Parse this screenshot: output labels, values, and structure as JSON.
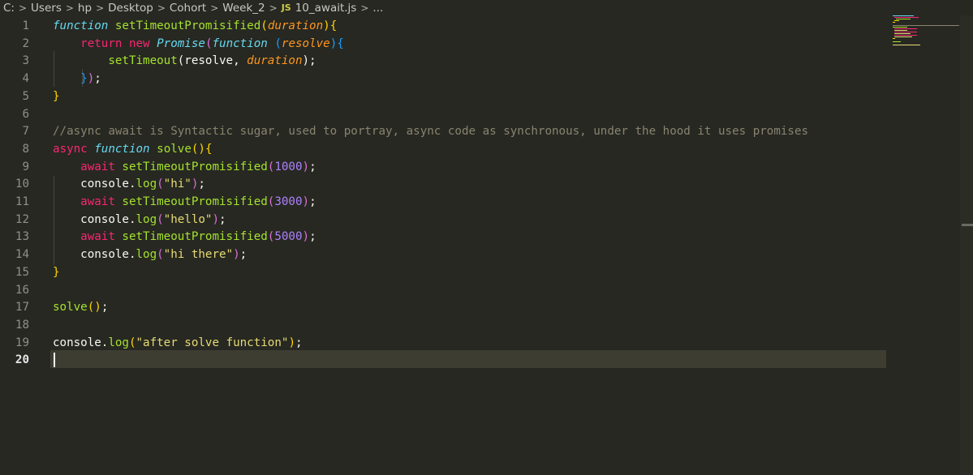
{
  "breadcrumb": {
    "items": [
      "C:",
      "Users",
      "hp",
      "Desktop",
      "Cohort",
      "Week_2"
    ],
    "file_badge": "JS",
    "file_name": "10_await.js",
    "trailing": "..."
  },
  "editor": {
    "current_line": 20,
    "lines": [
      {
        "n": "1",
        "tokens": [
          {
            "t": "function",
            "c": "fnkw"
          },
          {
            "t": " ",
            "c": "plain"
          },
          {
            "t": "setTimeoutPromisified",
            "c": "fn"
          },
          {
            "t": "(",
            "c": "b1"
          },
          {
            "t": "duration",
            "c": "param"
          },
          {
            "t": "){",
            "c": "b1"
          }
        ]
      },
      {
        "n": "2",
        "tokens": [
          {
            "t": "    return",
            "c": "kw"
          },
          {
            "t": " ",
            "c": "plain"
          },
          {
            "t": "new",
            "c": "kw"
          },
          {
            "t": " ",
            "c": "plain"
          },
          {
            "t": "Promise",
            "c": "type"
          },
          {
            "t": "(",
            "c": "b2"
          },
          {
            "t": "function",
            "c": "fnkw"
          },
          {
            "t": " (",
            "c": "b3"
          },
          {
            "t": "resolve",
            "c": "param"
          },
          {
            "t": "){",
            "c": "b3"
          }
        ]
      },
      {
        "n": "3",
        "tokens": [
          {
            "t": "        setTimeout",
            "c": "fn"
          },
          {
            "t": "(resolve, ",
            "c": "plain"
          },
          {
            "t": "duration",
            "c": "param"
          },
          {
            "t": ");",
            "c": "plain"
          }
        ]
      },
      {
        "n": "4",
        "tokens": [
          {
            "t": "    }",
            "c": "b3"
          },
          {
            "t": ")",
            "c": "b2"
          },
          {
            "t": ";",
            "c": "plain"
          }
        ]
      },
      {
        "n": "5",
        "tokens": [
          {
            "t": "}",
            "c": "b1"
          }
        ]
      },
      {
        "n": "6",
        "tokens": []
      },
      {
        "n": "7",
        "tokens": [
          {
            "t": "//async await is Syntactic sugar, used to portray, async code as synchronous, under the hood it uses promises",
            "c": "cm"
          }
        ]
      },
      {
        "n": "8",
        "tokens": [
          {
            "t": "async",
            "c": "kw"
          },
          {
            "t": " ",
            "c": "plain"
          },
          {
            "t": "function",
            "c": "fnkw"
          },
          {
            "t": " ",
            "c": "plain"
          },
          {
            "t": "solve",
            "c": "fn"
          },
          {
            "t": "(){",
            "c": "b1"
          }
        ]
      },
      {
        "n": "9",
        "tokens": [
          {
            "t": "    await",
            "c": "kw"
          },
          {
            "t": " ",
            "c": "plain"
          },
          {
            "t": "setTimeoutPromisified",
            "c": "fn"
          },
          {
            "t": "(",
            "c": "b2"
          },
          {
            "t": "1000",
            "c": "num"
          },
          {
            "t": ")",
            "c": "b2"
          },
          {
            "t": ";",
            "c": "plain"
          }
        ]
      },
      {
        "n": "10",
        "tokens": [
          {
            "t": "    console.",
            "c": "plain"
          },
          {
            "t": "log",
            "c": "fn"
          },
          {
            "t": "(",
            "c": "b2"
          },
          {
            "t": "\"hi\"",
            "c": "str"
          },
          {
            "t": ")",
            "c": "b2"
          },
          {
            "t": ";",
            "c": "plain"
          }
        ]
      },
      {
        "n": "11",
        "tokens": [
          {
            "t": "    await",
            "c": "kw"
          },
          {
            "t": " ",
            "c": "plain"
          },
          {
            "t": "setTimeoutPromisified",
            "c": "fn"
          },
          {
            "t": "(",
            "c": "b2"
          },
          {
            "t": "3000",
            "c": "num"
          },
          {
            "t": ")",
            "c": "b2"
          },
          {
            "t": ";",
            "c": "plain"
          }
        ]
      },
      {
        "n": "12",
        "tokens": [
          {
            "t": "    console.",
            "c": "plain"
          },
          {
            "t": "log",
            "c": "fn"
          },
          {
            "t": "(",
            "c": "b2"
          },
          {
            "t": "\"hello\"",
            "c": "str"
          },
          {
            "t": ")",
            "c": "b2"
          },
          {
            "t": ";",
            "c": "plain"
          }
        ]
      },
      {
        "n": "13",
        "tokens": [
          {
            "t": "    await",
            "c": "kw"
          },
          {
            "t": " ",
            "c": "plain"
          },
          {
            "t": "setTimeoutPromisified",
            "c": "fn"
          },
          {
            "t": "(",
            "c": "b2"
          },
          {
            "t": "5000",
            "c": "num"
          },
          {
            "t": ")",
            "c": "b2"
          },
          {
            "t": ";",
            "c": "plain"
          }
        ]
      },
      {
        "n": "14",
        "tokens": [
          {
            "t": "    console.",
            "c": "plain"
          },
          {
            "t": "log",
            "c": "fn"
          },
          {
            "t": "(",
            "c": "b2"
          },
          {
            "t": "\"hi there\"",
            "c": "str"
          },
          {
            "t": ")",
            "c": "b2"
          },
          {
            "t": ";",
            "c": "plain"
          }
        ]
      },
      {
        "n": "15",
        "tokens": [
          {
            "t": "}",
            "c": "b1"
          }
        ]
      },
      {
        "n": "16",
        "tokens": []
      },
      {
        "n": "17",
        "tokens": [
          {
            "t": "solve",
            "c": "fn"
          },
          {
            "t": "()",
            "c": "b1"
          },
          {
            "t": ";",
            "c": "plain"
          }
        ]
      },
      {
        "n": "18",
        "tokens": []
      },
      {
        "n": "19",
        "tokens": [
          {
            "t": "console.",
            "c": "plain"
          },
          {
            "t": "log",
            "c": "fn"
          },
          {
            "t": "(",
            "c": "b1"
          },
          {
            "t": "\"after solve function\"",
            "c": "str"
          },
          {
            "t": ")",
            "c": "b1"
          },
          {
            "t": ";",
            "c": "plain"
          }
        ]
      },
      {
        "n": "20",
        "tokens": []
      }
    ]
  },
  "colors": {
    "background": "#272822",
    "keyword": "#f92672",
    "function": "#a6e22e",
    "string": "#e6db74",
    "number": "#ae81ff",
    "comment": "#88846f",
    "parameter": "#fd971f",
    "storage": "#66d9ef"
  },
  "icons": {
    "separator": "chevron-right-icon",
    "file": "javascript-file-icon"
  }
}
